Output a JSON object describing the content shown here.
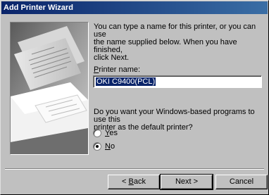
{
  "window": {
    "title": "Add Printer Wizard"
  },
  "intro_text": "You can type a name for this printer, or you can use\nthe name supplied below. When you have finished,\nclick Next.",
  "printer_name": {
    "label_prefix": "",
    "label_accel": "P",
    "label_rest": "rinter name:",
    "value": "OKI C9400(PCL)"
  },
  "default_question": "Do you want your Windows-based programs to use this\nprinter as the default printer?",
  "options": {
    "yes": {
      "accel": "Y",
      "rest": "es",
      "selected": false
    },
    "no": {
      "accel": "N",
      "rest": "o",
      "selected": true
    }
  },
  "buttons": {
    "back": {
      "prefix": "< ",
      "accel": "B",
      "rest": "ack"
    },
    "next": "Next >",
    "cancel": "Cancel"
  },
  "colors": {
    "titlebar_start": "#0a246a",
    "titlebar_end": "#3a6ea5",
    "face": "#c0c0c0"
  },
  "illustration": "printer-with-paper-photo"
}
